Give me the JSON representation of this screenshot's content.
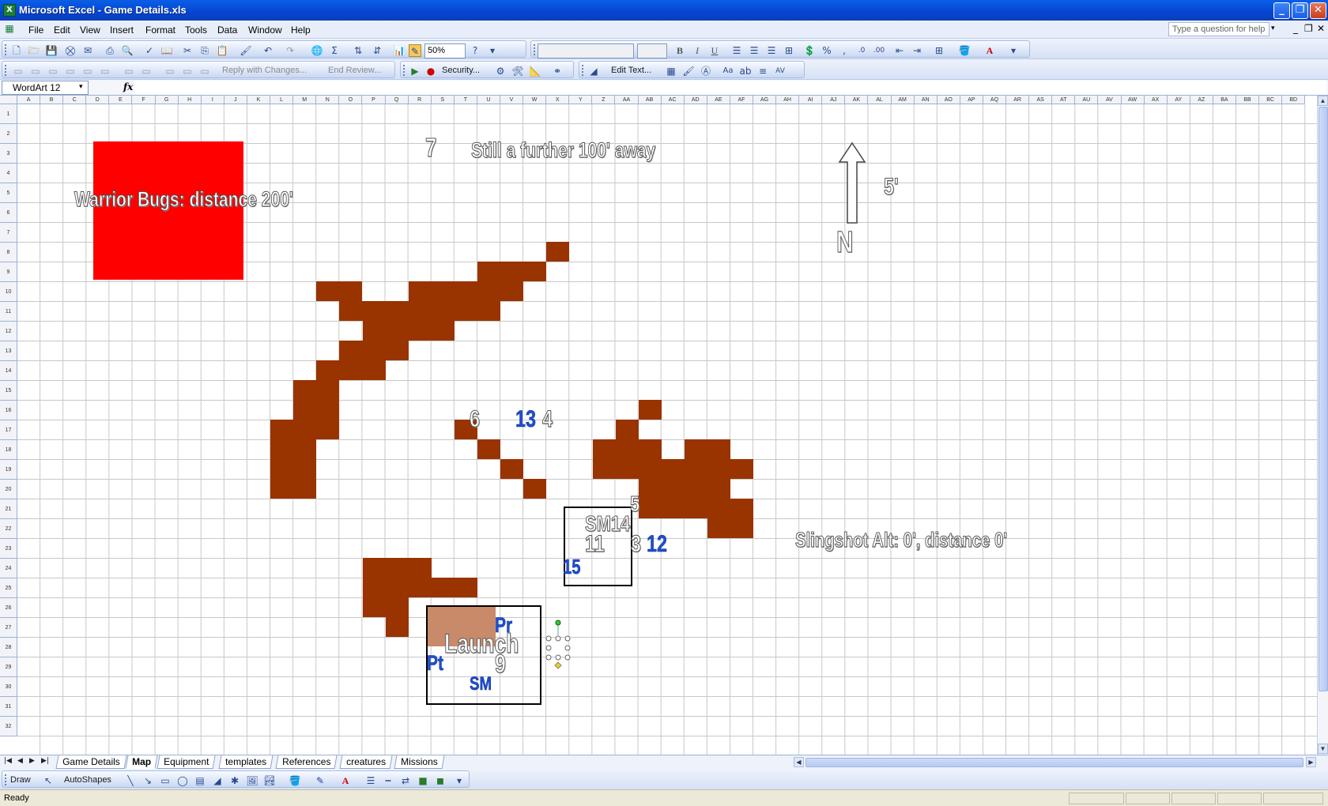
{
  "window": {
    "title": "Microsoft Excel - Game Details.xls",
    "minimize": "_",
    "restore": "❐",
    "close": "✕"
  },
  "menu": [
    {
      "label": "File"
    },
    {
      "label": "Edit"
    },
    {
      "label": "View"
    },
    {
      "label": "Insert"
    },
    {
      "label": "Format"
    },
    {
      "label": "Tools"
    },
    {
      "label": "Data"
    },
    {
      "label": "Window"
    },
    {
      "label": "Help"
    }
  ],
  "help_box": {
    "placeholder": "Type a question for help"
  },
  "toolbar": {
    "zoom": "50%",
    "font": "",
    "size": "",
    "bold": "B",
    "italic": "I",
    "underline": "U"
  },
  "reviewing": {
    "reply": "Reply with Changes...",
    "end_review": "End Review...",
    "security": "Security..."
  },
  "wordart_toolbar": {
    "edit_text": "Edit Text..."
  },
  "formula_bar": {
    "name_box": "WordArt 12",
    "fx": "fx",
    "content": ""
  },
  "columns": [
    "A",
    "B",
    "C",
    "D",
    "E",
    "F",
    "G",
    "H",
    "I",
    "J",
    "K",
    "L",
    "M",
    "N",
    "O",
    "P",
    "Q",
    "R",
    "S",
    "T",
    "U",
    "V",
    "W",
    "X",
    "Y",
    "Z",
    "AA",
    "AB",
    "AC",
    "AD",
    "AE",
    "AF",
    "AG",
    "AH",
    "AI",
    "AJ",
    "AK",
    "AL",
    "AM",
    "AN",
    "AO",
    "AP",
    "AQ",
    "AR",
    "AS",
    "AT",
    "AU",
    "AV",
    "AW",
    "AX",
    "AY",
    "AZ",
    "BA",
    "BB",
    "BC",
    "BD"
  ],
  "rows": [
    "1",
    "2",
    "3",
    "4",
    "5",
    "6",
    "7",
    "8",
    "9",
    "10",
    "11",
    "12",
    "13",
    "14",
    "15",
    "16",
    "17",
    "18",
    "19",
    "20",
    "21",
    "22",
    "23",
    "24",
    "25",
    "26",
    "27",
    "28",
    "29",
    "30",
    "31",
    "32"
  ],
  "map": {
    "warrior_bugs": "Warrior Bugs: distance 200'",
    "seven": "7",
    "still_further": "Still a further 100' away",
    "five_ft": "5'",
    "north": "N",
    "six": "6",
    "thirteen": "13",
    "four": "4",
    "five": "5",
    "sm14": "SM14",
    "eleven": "11",
    "three": "3",
    "twelve": "12",
    "fifteen": "15",
    "slingshot": "Slingshot Alt: 0', distance 0'",
    "pr": "Pr",
    "launch": "Launch",
    "pt": "Pt",
    "nine": "9",
    "sm": "SM"
  },
  "sheets": [
    {
      "label": "Game Details",
      "active": false
    },
    {
      "label": "Map",
      "active": true
    },
    {
      "label": "Equipment",
      "active": false
    },
    {
      "label": "templates",
      "active": false
    },
    {
      "label": "References",
      "active": false
    },
    {
      "label": "creatures",
      "active": false
    },
    {
      "label": "Missions",
      "active": false
    }
  ],
  "drawbar": {
    "draw": "Draw",
    "autoshapes": "AutoShapes"
  },
  "status": {
    "text": "Ready"
  },
  "colors": {
    "terrain": "#993300",
    "red_zone": "#ff0000",
    "light_terrain": "#c98a6a",
    "blue_label": "#1f4fd0"
  }
}
